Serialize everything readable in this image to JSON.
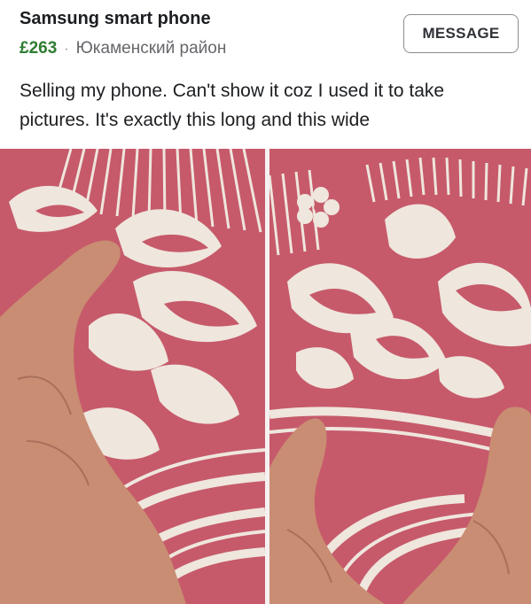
{
  "listing": {
    "title": "Samsung smart phone",
    "price": "£263",
    "separator": "·",
    "location": "Юкаменский район",
    "message_label": "MESSAGE",
    "description": "Selling my phone. Can't show it coz I used it to take pictures. It's exactly this long and this wide"
  },
  "colors": {
    "fabric_red": "#c65a6a",
    "fabric_cream": "#efe6dd",
    "skin": "#c98d73",
    "price_green": "#2e7d32"
  },
  "photos": [
    {
      "name": "left-photo",
      "depicts": "hand-on-patterned-fabric"
    },
    {
      "name": "right-photo",
      "depicts": "hand-on-patterned-fabric"
    }
  ]
}
